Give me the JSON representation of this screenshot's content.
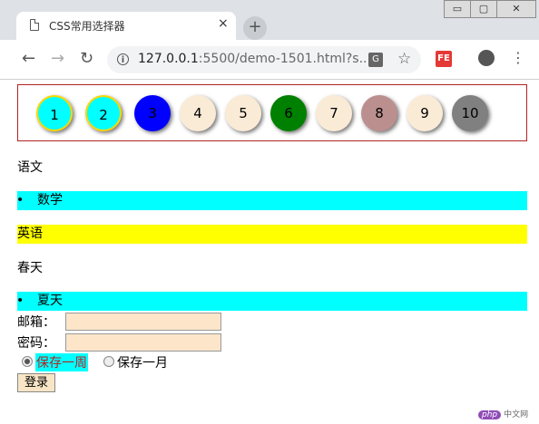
{
  "browser": {
    "tab_title": "CSS常用选择器",
    "close_glyph": "×",
    "new_tab_glyph": "+",
    "url_host": "127.0.0.1",
    "url_rest": ":5500/demo-1501.html?s...",
    "extension_label": "FE",
    "window_controls": [
      "▭",
      "▢",
      "✕"
    ]
  },
  "circles": [
    {
      "label": "1",
      "bg": "#00ffff",
      "border": "#ffd700"
    },
    {
      "label": "2",
      "bg": "#00ffff",
      "border": "#ffd700"
    },
    {
      "label": "3",
      "bg": "#0000ff",
      "border": "none"
    },
    {
      "label": "4",
      "bg": "#faebd7",
      "border": "none"
    },
    {
      "label": "5",
      "bg": "#faebd7",
      "border": "none"
    },
    {
      "label": "6",
      "bg": "#008000",
      "border": "none"
    },
    {
      "label": "7",
      "bg": "#faebd7",
      "border": "none"
    },
    {
      "label": "8",
      "bg": "#bc8f8f",
      "border": "none"
    },
    {
      "label": "9",
      "bg": "#faebd7",
      "border": "none"
    },
    {
      "label": "10",
      "bg": "#808080",
      "border": "none"
    }
  ],
  "subjects": {
    "chinese": "语文",
    "math": "数学",
    "english": "英语"
  },
  "seasons": {
    "spring": "春天",
    "summer": "夏天"
  },
  "form": {
    "email_label": "邮箱：",
    "password_label": "密码：",
    "radio_week": "保存一周",
    "radio_month": "保存一月",
    "login_label": "登录"
  },
  "watermark": {
    "php": "php",
    "site": "中文网"
  },
  "colors": {
    "cyan_highlight": "#00ffff",
    "yellow_highlight": "#ffff00",
    "input_bg": "#fde5ca"
  }
}
